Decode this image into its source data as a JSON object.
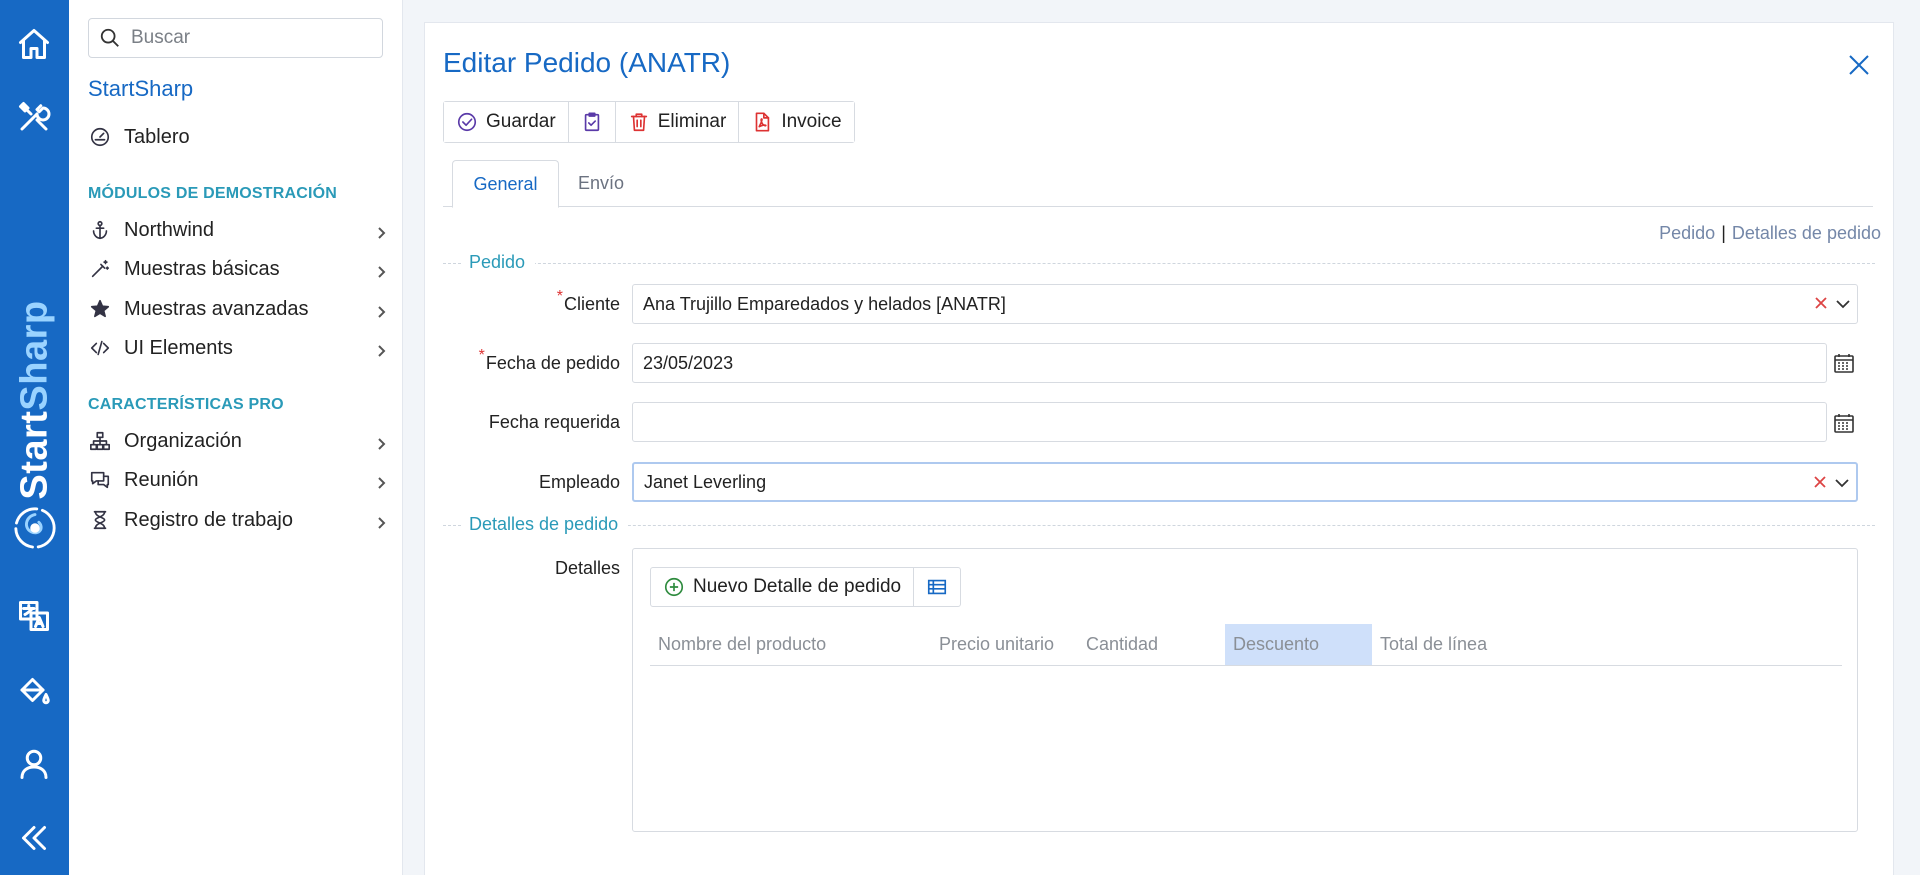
{
  "rail": {
    "icons": [
      "home-icon",
      "tools-icon",
      "translate-icon",
      "paint-bucket-icon",
      "user-icon",
      "collapse-icon"
    ],
    "brand_start": "Start",
    "brand_sharp": "Sharp"
  },
  "sidebar": {
    "search_placeholder": "Buscar",
    "app_name": "StartSharp",
    "dashboard": "Tablero",
    "section_demo": "MÓDULOS DE DEMOSTRACIÓN",
    "demo_items": [
      "Northwind",
      "Muestras básicas",
      "Muestras avanzadas",
      "UI Elements"
    ],
    "section_pro": "CARACTERÍSTICAS PRO",
    "pro_items": [
      "Organización",
      "Reunión",
      "Registro de trabajo"
    ]
  },
  "dialog": {
    "title": "Editar Pedido (ANATR)",
    "toolbar": {
      "save": "Guardar",
      "delete": "Eliminar",
      "invoice": "Invoice"
    },
    "tabs": [
      "General",
      "Envío"
    ],
    "category_links": [
      "Pedido",
      "Detalles de pedido"
    ],
    "category_sep": "|",
    "cat_order": "Pedido",
    "cat_details": "Detalles de pedido",
    "required_mark": "*",
    "fields": {
      "customer_label": "Cliente",
      "customer_value": "Ana Trujillo Emparedados y helados [ANATR]",
      "order_date_label": "Fecha de pedido",
      "order_date_value": "23/05/2023",
      "required_date_label": "Fecha requerida",
      "required_date_value": "",
      "employee_label": "Empleado",
      "employee_value": "Janet Leverling",
      "details_label": "Detalles"
    },
    "grid": {
      "new_button": "Nuevo Detalle de pedido",
      "columns": [
        "Nombre del producto",
        "Precio unitario",
        "Cantidad",
        "Descuento",
        "Total de línea"
      ],
      "selected_column": "Descuento"
    }
  },
  "colors": {
    "brand": "#1769c4",
    "accent": "#2a9ab8",
    "required": "#d33"
  }
}
